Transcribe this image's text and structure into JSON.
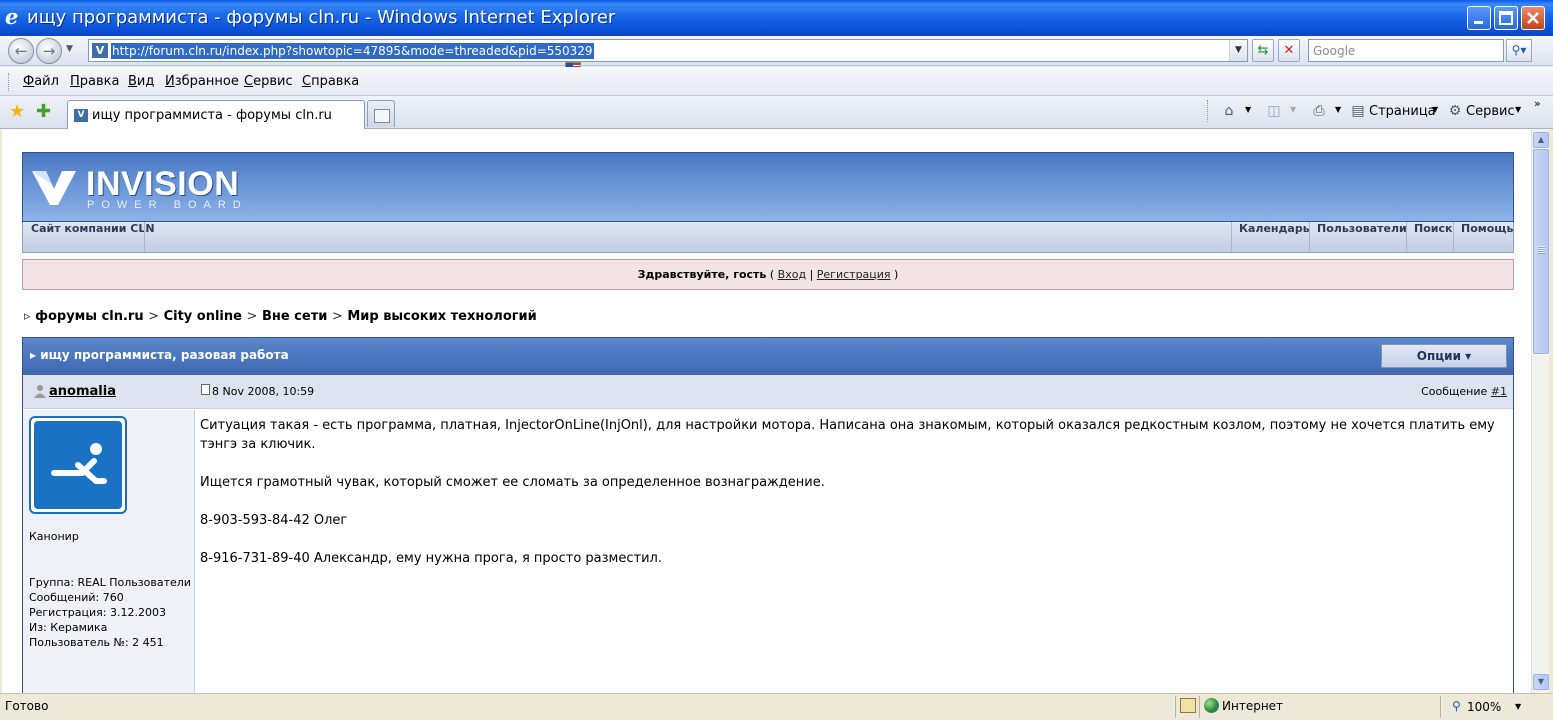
{
  "window": {
    "title": "ищу программиста - форумы cln.ru - Windows Internet Explorer"
  },
  "address": {
    "url": "http://forum.cln.ru/index.php?showtopic=47895&mode=threaded&pid=550329"
  },
  "search": {
    "placeholder": "Google"
  },
  "menu": {
    "items": [
      "Файл",
      "Правка",
      "Вид",
      "Избранное",
      "Сервис",
      "Справка"
    ]
  },
  "tabs": {
    "active": "ищу программиста - форумы cln.ru"
  },
  "toolbar": {
    "page_label": "Страница",
    "tools_label": "Сервис"
  },
  "forum": {
    "logo_main": "INVISION",
    "logo_sub": "POWER BOARD",
    "nav_left": "Сайт компании CLN",
    "nav_right": [
      "Календарь",
      "Пользователи",
      "Поиск",
      "Помощь"
    ],
    "welcome": {
      "greeting": "Здравствуйте, гость",
      "open_paren": "(",
      "login": "Вход",
      "divider": "|",
      "register": "Регистрация",
      "close_paren": ")"
    },
    "breadcrumb": [
      "форумы cln.ru",
      "City online",
      "Вне сети",
      "Мир высоких технологий"
    ],
    "breadcrumb_sep": ">",
    "topic_title": "ищу программиста, разовая работа",
    "options_label": "Опции"
  },
  "post": {
    "author": "anomalia",
    "date": "8 Nov 2008, 10:59",
    "message_label": "Сообщение",
    "message_number": "#1",
    "rank": "Канонир",
    "group": "Группа: REAL Пользователи",
    "messages": "Сообщений: 760",
    "registered": "Регистрация: 3.12.2003",
    "from": "Из: Керамика",
    "user_no": "Пользователь №: 2 451",
    "body": [
      "Ситуация такая - есть программа, платная, InjectorOnLine(InjOnl), для настройки мотора. Написана она знакомым, который оказался редкостным козлом, поэтому не хочется платить ему тэнгэ за ключик.",
      "Ищется грамотный чувак, который сможет ее сломать за определенное вознаграждение.",
      "8-903-593-84-42 Олег",
      "8-916-731-89-40 Александр, ему нужна прога, я просто разместил."
    ]
  },
  "status": {
    "text": "Готово",
    "zone": "Интернет",
    "zoom": "100%"
  }
}
